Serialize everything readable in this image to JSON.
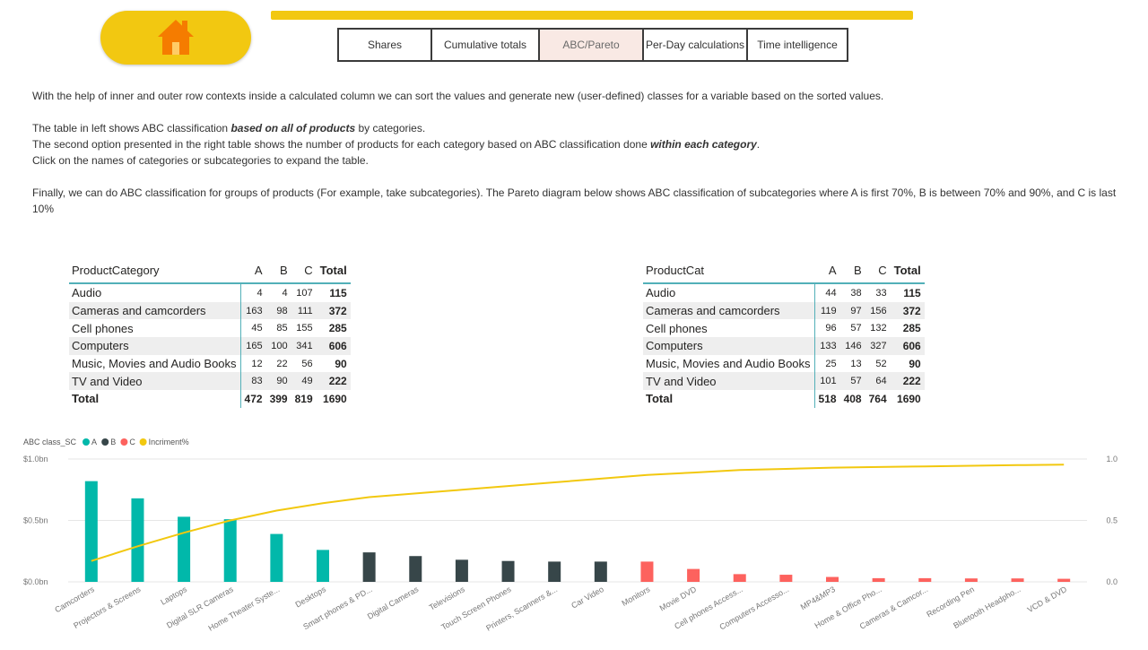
{
  "nav": {
    "home_icon": "home-icon",
    "tabs": [
      {
        "label": "Shares",
        "active": false
      },
      {
        "label": "Cumulative totals",
        "active": false
      },
      {
        "label": "ABC/Pareto",
        "active": true
      },
      {
        "label": "Per-Day calculations",
        "active": false
      },
      {
        "label": "Time intelligence",
        "active": false
      }
    ]
  },
  "colors": {
    "A": "#01b8aa",
    "B": "#374649",
    "C": "#fd625e",
    "line": "#f2c80f",
    "accent": "#f2c811",
    "table_rule": "#52b0b8"
  },
  "description": {
    "p1": "With the help of inner and outer row contexts inside a calculated column we can sort the values and generate new (user-defined) classes for a variable based on the sorted values.",
    "p2_pre": " The table in left shows ABC classification ",
    "p2_em": "based on all of products",
    "p2_post": " by categories.",
    "p3_pre": "The second option presented in the right table shows the number of products for each category based on ABC classification done ",
    "p3_em": "within each category",
    "p3_post": ".",
    "p4": "Click on the names of categories or subcategories to expand the table.",
    "p5": "Finally, we can do ABC classification for groups of products (For example, take subcategories). The Pareto diagram below shows ABC classification of subcategories where A is first 70%, B is between 70% and 90%, and C is last 10%"
  },
  "table_left": {
    "row_header": "ProductCategory",
    "columns": [
      "A",
      "B",
      "C",
      "Total"
    ],
    "rows": [
      {
        "label": "Audio",
        "A": "4",
        "B": "4",
        "C": "107",
        "Total": "115"
      },
      {
        "label": "Cameras and camcorders",
        "A": "163",
        "B": "98",
        "C": "111",
        "Total": "372"
      },
      {
        "label": "Cell phones",
        "A": "45",
        "B": "85",
        "C": "155",
        "Total": "285"
      },
      {
        "label": "Computers",
        "A": "165",
        "B": "100",
        "C": "341",
        "Total": "606"
      },
      {
        "label": "Music, Movies and Audio Books",
        "A": "12",
        "B": "22",
        "C": "56",
        "Total": "90"
      },
      {
        "label": "TV and Video",
        "A": "83",
        "B": "90",
        "C": "49",
        "Total": "222"
      }
    ],
    "total": {
      "label": "Total",
      "A": "472",
      "B": "399",
      "C": "819",
      "Total": "1690"
    }
  },
  "table_right": {
    "row_header": "ProductCat",
    "columns": [
      "A",
      "B",
      "C",
      "Total"
    ],
    "rows": [
      {
        "label": "Audio",
        "A": "44",
        "B": "38",
        "C": "33",
        "Total": "115"
      },
      {
        "label": "Cameras and camcorders",
        "A": "119",
        "B": "97",
        "C": "156",
        "Total": "372"
      },
      {
        "label": "Cell phones",
        "A": "96",
        "B": "57",
        "C": "132",
        "Total": "285"
      },
      {
        "label": "Computers",
        "A": "133",
        "B": "146",
        "C": "327",
        "Total": "606"
      },
      {
        "label": "Music, Movies and Audio Books",
        "A": "25",
        "B": "13",
        "C": "52",
        "Total": "90"
      },
      {
        "label": "TV and Video",
        "A": "101",
        "B": "57",
        "C": "64",
        "Total": "222"
      }
    ],
    "total": {
      "label": "Total",
      "A": "518",
      "B": "408",
      "C": "764",
      "Total": "1690"
    }
  },
  "chart_data": {
    "type": "bar",
    "title": "",
    "legend": {
      "title": "ABC class_SC",
      "items": [
        {
          "name": "A",
          "color": "#01b8aa"
        },
        {
          "name": "B",
          "color": "#374649"
        },
        {
          "name": "C",
          "color": "#fd625e"
        },
        {
          "name": "Incriment%",
          "color": "#f2c80f"
        }
      ],
      "placement": "top-left"
    },
    "categories": [
      "Camcorders",
      "Projectors & Screens",
      "Laptops",
      "Digital SLR Cameras",
      "Home Theater Syste...",
      "Desktops",
      "Smart phones & PD...",
      "Digital Cameras",
      "Televisions",
      "Touch Screen Phones",
      "Printers, Scanners &...",
      "Car Video",
      "Monitors",
      "Movie DVD",
      "Cell phones Access...",
      "Computers Accesso...",
      "MP4&MP3",
      "Home & Office Pho...",
      "Cameras & Camcor...",
      "Recording Pen",
      "Bluetooth Headpho...",
      "VCD & DVD"
    ],
    "classes": [
      "A",
      "A",
      "A",
      "A",
      "A",
      "A",
      "B",
      "B",
      "B",
      "B",
      "B",
      "B",
      "C",
      "C",
      "C",
      "C",
      "C",
      "C",
      "C",
      "C",
      "C",
      "C"
    ],
    "values": [
      0.82,
      0.68,
      0.53,
      0.51,
      0.39,
      0.26,
      0.24,
      0.21,
      0.18,
      0.17,
      0.165,
      0.165,
      0.165,
      0.105,
      0.063,
      0.058,
      0.04,
      0.03,
      0.03,
      0.028,
      0.028,
      0.025
    ],
    "line": {
      "name": "Incriment%",
      "values": [
        0.17,
        0.29,
        0.4,
        0.5,
        0.58,
        0.64,
        0.69,
        0.72,
        0.75,
        0.78,
        0.81,
        0.84,
        0.87,
        0.89,
        0.91,
        0.92,
        0.93,
        0.935,
        0.94,
        0.945,
        0.95,
        0.955
      ]
    },
    "y_left": {
      "ticks": [
        "$0.0bn",
        "$0.5bn",
        "$1.0bn"
      ],
      "tick_values": [
        0,
        0.5,
        1.0
      ],
      "lim": [
        0,
        1.0
      ]
    },
    "y_right": {
      "ticks": [
        "0.0",
        "0.5",
        "1.0"
      ],
      "tick_values": [
        0,
        0.5,
        1.0
      ],
      "lim": [
        0,
        1.0
      ]
    },
    "grid": true
  }
}
